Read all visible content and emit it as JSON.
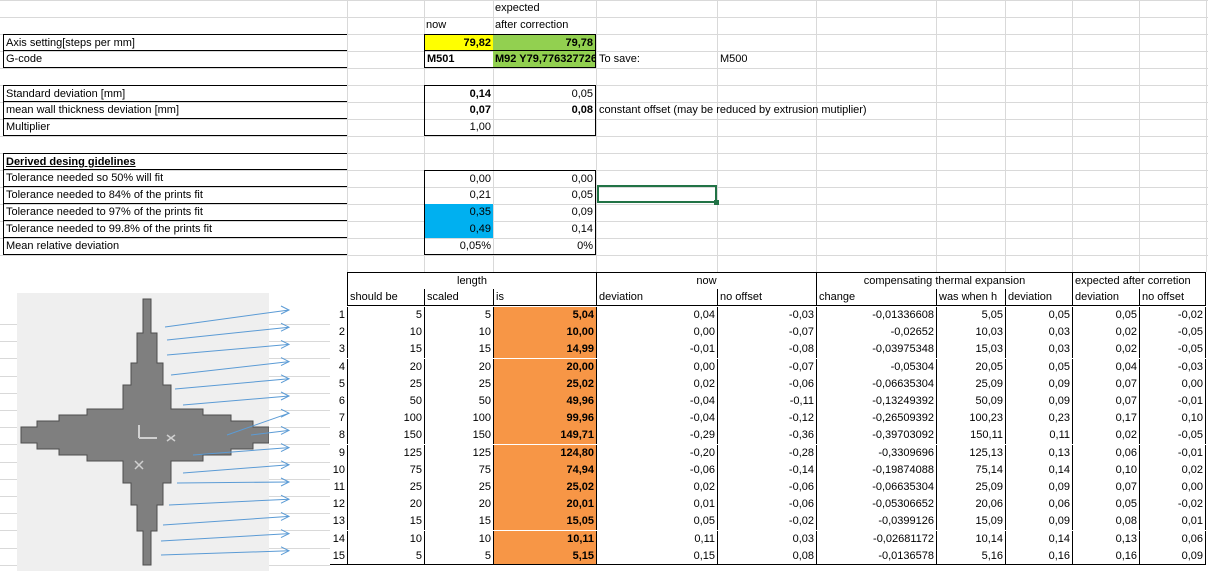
{
  "top": {
    "hdr_expected": "expected",
    "hdr_now": "now",
    "hdr_after": "after correction",
    "axis_label": "Axis setting[steps per mm]",
    "axis_now": "79,82",
    "axis_after": "79,78",
    "gcode_label": "G-code",
    "gcode_now": "M501",
    "gcode_after": "M92 Y79,776327726",
    "to_save": "To save:",
    "save_code": "M500",
    "std_label": "Standard deviation [mm]",
    "std_now": "0,14",
    "std_after": "0,05",
    "mean_label": "mean wall thickness deviation [mm]",
    "mean_now": "0,07",
    "mean_after": "0,08",
    "offset_note": "constant offset (may be reduced by extrusion mutiplier)",
    "mult_label": "Multiplier",
    "mult_now": "1,00",
    "derived_title": "Derived desing gidelines",
    "tol50_label": "Tolerance needed so 50% will fit",
    "tol50_now": "0,00",
    "tol50_after": "0,00",
    "tol84_label": "Tolerance needed to 84% of the prints fit",
    "tol84_now": "0,21",
    "tol84_after": "0,05",
    "tol97_label": "Tolerance needed to 97% of the prints fit",
    "tol97_now": "0,35",
    "tol97_after": "0,09",
    "tol998_label": "Tolerance needed to 99.8% of the prints fit",
    "tol998_now": "0,49",
    "tol998_after": "0,14",
    "mrd_label": "Mean relative deviation",
    "mrd_now": "0,05%",
    "mrd_after": "0%"
  },
  "table": {
    "h_length": "length",
    "h_now": "now",
    "h_comp": "compensating thermal expansion",
    "h_expected": "expected after corretion",
    "h_should": "should be",
    "h_scaled": "scaled",
    "h_is": "is",
    "h_deviation": "deviation",
    "h_nooffset": "no offset",
    "h_change": "change",
    "h_washen": "was when h",
    "h_deviation2": "deviation",
    "h_deviation3": "deviation",
    "h_nooffset2": "no offset",
    "rows": [
      [
        "1",
        "5",
        "5",
        "5,04",
        "0,04",
        "-0,03",
        "-0,01336608",
        "5,05",
        "0,05",
        "0,05",
        "-0,02"
      ],
      [
        "2",
        "10",
        "10",
        "10,00",
        "0,00",
        "-0,07",
        "-0,02652",
        "10,03",
        "0,03",
        "0,02",
        "-0,05"
      ],
      [
        "3",
        "15",
        "15",
        "14,99",
        "-0,01",
        "-0,08",
        "-0,03975348",
        "15,03",
        "0,03",
        "0,02",
        "-0,05"
      ],
      [
        "4",
        "20",
        "20",
        "20,00",
        "0,00",
        "-0,07",
        "-0,05304",
        "20,05",
        "0,05",
        "0,04",
        "-0,03"
      ],
      [
        "5",
        "25",
        "25",
        "25,02",
        "0,02",
        "-0,06",
        "-0,06635304",
        "25,09",
        "0,09",
        "0,07",
        "0,00"
      ],
      [
        "6",
        "50",
        "50",
        "49,96",
        "-0,04",
        "-0,11",
        "-0,13249392",
        "50,09",
        "0,09",
        "0,07",
        "-0,01"
      ],
      [
        "7",
        "100",
        "100",
        "99,96",
        "-0,04",
        "-0,12",
        "-0,26509392",
        "100,23",
        "0,23",
        "0,17",
        "0,10"
      ],
      [
        "8",
        "150",
        "150",
        "149,71",
        "-0,29",
        "-0,36",
        "-0,39703092",
        "150,11",
        "0,11",
        "0,02",
        "-0,05"
      ],
      [
        "9",
        "125",
        "125",
        "124,80",
        "-0,20",
        "-0,28",
        "-0,3309696",
        "125,13",
        "0,13",
        "0,06",
        "-0,01"
      ],
      [
        "10",
        "75",
        "75",
        "74,94",
        "-0,06",
        "-0,14",
        "-0,19874088",
        "75,14",
        "0,14",
        "0,10",
        "0,02"
      ],
      [
        "11",
        "25",
        "25",
        "25,02",
        "0,02",
        "-0,06",
        "-0,06635304",
        "25,09",
        "0,09",
        "0,07",
        "0,00"
      ],
      [
        "12",
        "20",
        "20",
        "20,01",
        "0,01",
        "-0,06",
        "-0,05306652",
        "20,06",
        "0,06",
        "0,05",
        "-0,02"
      ],
      [
        "13",
        "15",
        "15",
        "15,05",
        "0,05",
        "-0,02",
        "-0,0399126",
        "15,09",
        "0,09",
        "0,08",
        "0,01"
      ],
      [
        "14",
        "10",
        "10",
        "10,11",
        "0,11",
        "0,03",
        "-0,02681172",
        "10,14",
        "0,14",
        "0,13",
        "0,06"
      ],
      [
        "15",
        "5",
        "5",
        "5,15",
        "0,15",
        "0,08",
        "-0,0136578",
        "5,16",
        "0,16",
        "0,16",
        "0,09"
      ]
    ]
  },
  "colors": {
    "yellow": "#ffff00",
    "green": "#92d050",
    "blue": "#00b0f0",
    "orange": "#f79646",
    "selection": "#217346"
  }
}
